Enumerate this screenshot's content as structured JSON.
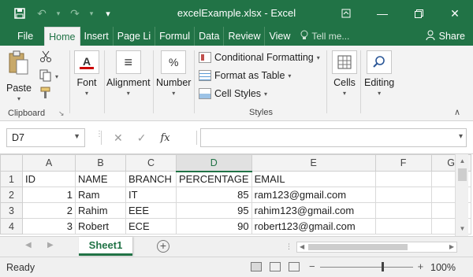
{
  "window": {
    "title": "excelExample.xlsx - Excel",
    "controls": {
      "ribbon_display": "⧉",
      "minimize": "—",
      "restore": "❐",
      "close": "✕"
    }
  },
  "qat": {
    "save": "💾",
    "undo": "↶",
    "redo": "↷",
    "customize": "▾"
  },
  "tabs": [
    "File",
    "Home",
    "Insert",
    "Page Li",
    "Formul",
    "Data",
    "Review",
    "View"
  ],
  "tell_me": {
    "icon": "⚉",
    "placeholder": "Tell me..."
  },
  "share": {
    "icon": "👤",
    "label": "Share"
  },
  "ribbon": {
    "clipboard": {
      "paste": "Paste",
      "label": "Clipboard",
      "launcher": "↘"
    },
    "font": {
      "label": "Font",
      "icon": "A"
    },
    "alignment": {
      "label": "Alignment",
      "icon": "≡"
    },
    "number": {
      "label": "Number",
      "icon": "%"
    },
    "styles": {
      "conditional_formatting": "Conditional Formatting",
      "format_as_table": "Format as Table",
      "cell_styles": "Cell Styles",
      "label": "Styles"
    },
    "cells": {
      "label": "Cells",
      "icon": "▦"
    },
    "editing": {
      "label": "Editing",
      "icon": "⌕"
    },
    "collapse": "∧"
  },
  "formula_bar": {
    "name_box": "D7",
    "cancel": "✕",
    "enter": "✓",
    "fx": "fx",
    "value": ""
  },
  "sheet": {
    "columns": [
      "A",
      "B",
      "C",
      "D",
      "E",
      "F",
      "G"
    ],
    "selected_column": "D",
    "rows": [
      {
        "num": "1",
        "cells": [
          "ID",
          "NAME",
          "BRANCH",
          "PERCENTAGE",
          "EMAIL",
          "",
          ""
        ]
      },
      {
        "num": "2",
        "cells": [
          "1",
          "Ram",
          "IT",
          "85",
          "ram123@gmail.com",
          "",
          ""
        ]
      },
      {
        "num": "3",
        "cells": [
          "2",
          "Rahim",
          "EEE",
          "95",
          "rahim123@gmail.com",
          "",
          ""
        ]
      },
      {
        "num": "4",
        "cells": [
          "3",
          "Robert",
          "ECE",
          "90",
          "robert123@gmail.com",
          "",
          ""
        ]
      }
    ]
  },
  "sheet_tabs": {
    "active": "Sheet1",
    "add": "+"
  },
  "status": {
    "ready": "Ready",
    "zoom_minus": "−",
    "zoom_plus": "+",
    "zoom": "100%"
  }
}
